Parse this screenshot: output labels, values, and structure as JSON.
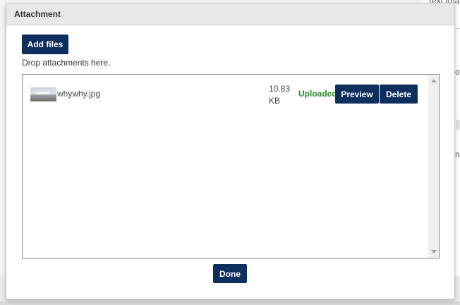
{
  "background": {
    "fragments": [
      "Text Ima",
      "ot",
      "n"
    ]
  },
  "dialog": {
    "title": "Attachment",
    "add_files_label": "Add files",
    "drop_hint": "Drop attachments here.",
    "files": [
      {
        "name": "whywhy.jpg",
        "size_value": "10.83",
        "size_unit": "KB",
        "status": "Uploaded",
        "preview_label": "Preview",
        "delete_label": "Delete"
      }
    ],
    "done_label": "Done"
  },
  "colors": {
    "accent": "#0e2f5e",
    "status_ok": "#2e8b2e",
    "header_bg": "#e8e8e8"
  }
}
